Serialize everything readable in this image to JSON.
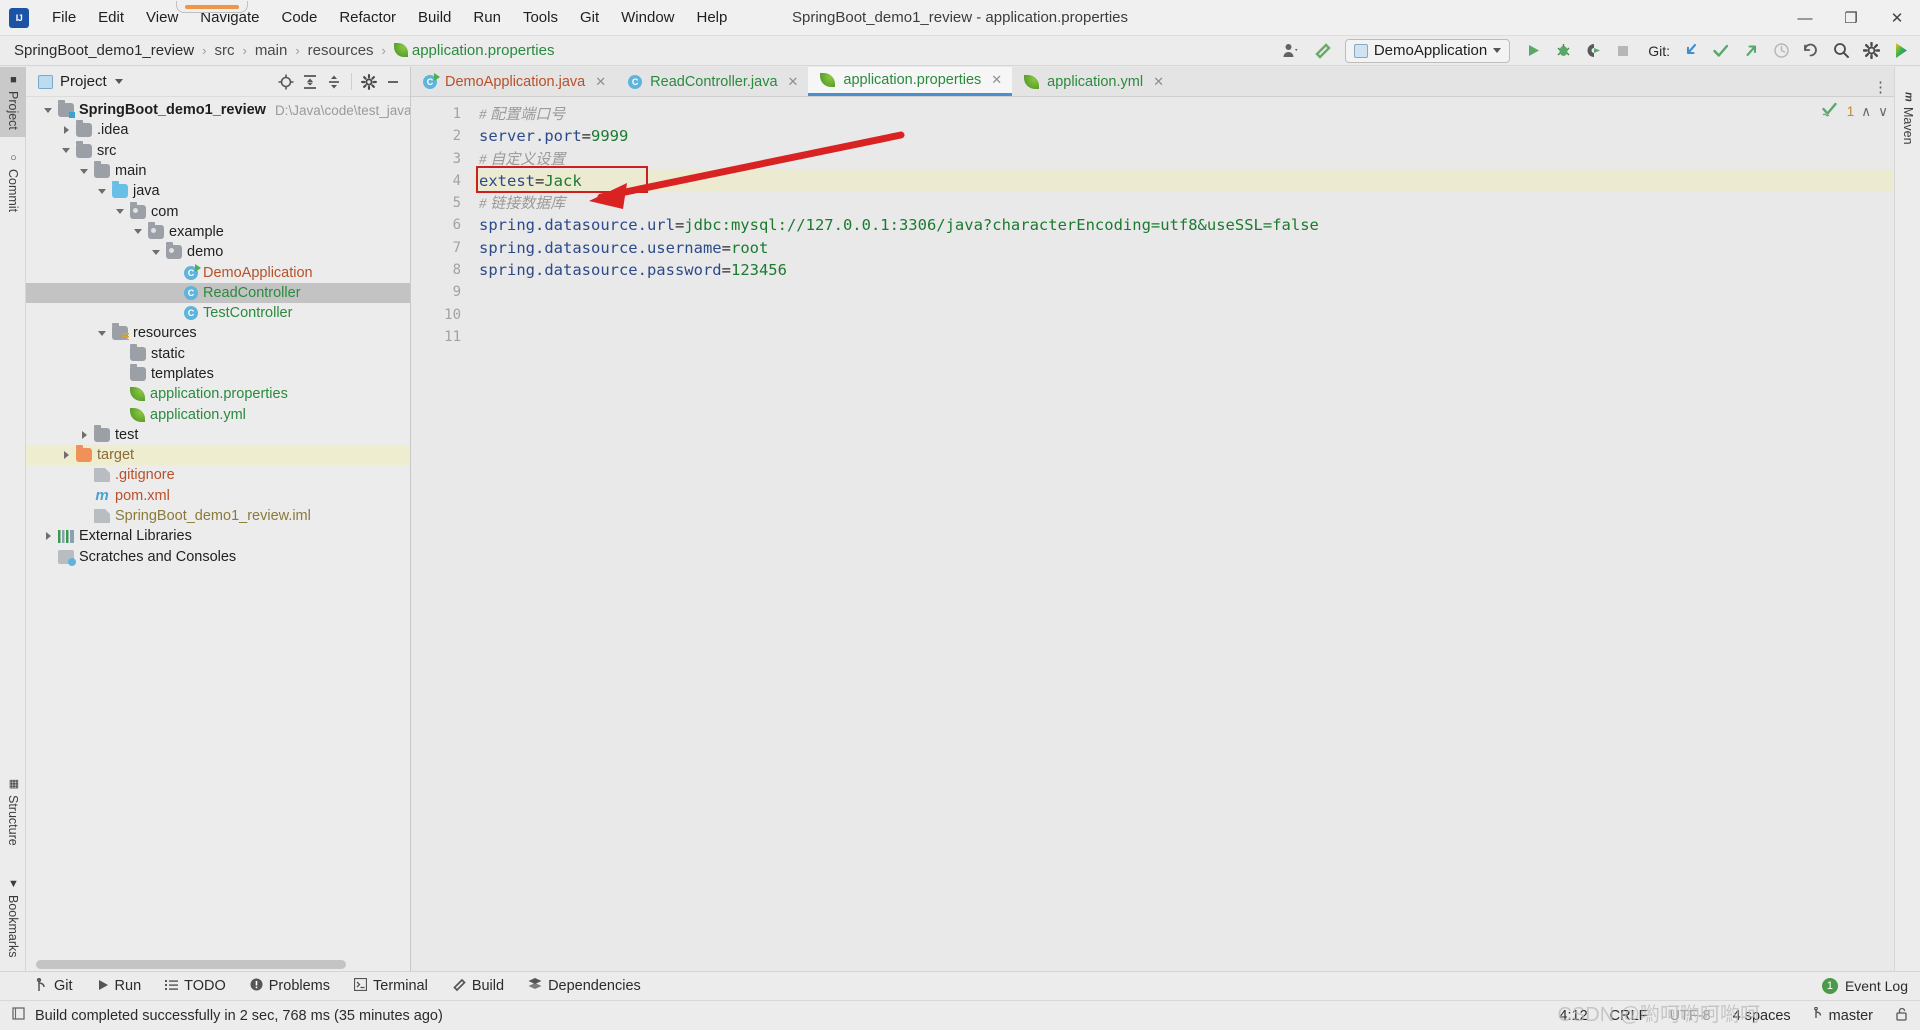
{
  "window": {
    "title": "SpringBoot_demo1_review - application.properties",
    "minimize": "—",
    "maximize": "❐",
    "close": "✕"
  },
  "menu": {
    "items": [
      {
        "label": "File"
      },
      {
        "label": "Edit"
      },
      {
        "label": "View"
      },
      {
        "label": "Navigate"
      },
      {
        "label": "Code"
      },
      {
        "label": "Refactor"
      },
      {
        "label": "Build"
      },
      {
        "label": "Run"
      },
      {
        "label": "Tools"
      },
      {
        "label": "Git"
      },
      {
        "label": "Window"
      },
      {
        "label": "Help"
      }
    ]
  },
  "breadcrumb": {
    "items": [
      {
        "label": "SpringBoot_demo1_review",
        "style": "plain"
      },
      {
        "label": "src",
        "style": "dim"
      },
      {
        "label": "main",
        "style": "dim"
      },
      {
        "label": "resources",
        "style": "dim"
      },
      {
        "label": "application.properties",
        "style": "green"
      }
    ],
    "separator": "›"
  },
  "toolbar": {
    "profile_icon": "user-profile-icon",
    "build_icon": "hammer-icon",
    "run_config": "DemoApplication",
    "run_label": "Run",
    "debug_label": "Debug",
    "coverage_label": "Run with Coverage",
    "stop_label": "Stop",
    "git_label": "Git:",
    "git_update_label": "Update Project",
    "git_commit_label": "Commit",
    "git_push_label": "Push",
    "git_history_label": "History",
    "git_rollback_label": "Rollback",
    "search_label": "Search Everywhere",
    "settings_label": "Settings",
    "ide_icon": "ide-gradient-icon"
  },
  "left_strip": {
    "items": [
      {
        "label": "Project",
        "icon": "project-folder-icon",
        "selected": true
      },
      {
        "label": "Commit",
        "icon": "commit-icon",
        "selected": false
      }
    ],
    "bottom_items": [
      {
        "label": "Structure",
        "icon": "structure-icon"
      },
      {
        "label": "Bookmarks",
        "icon": "bookmark-icon"
      }
    ]
  },
  "right_strip": {
    "items": [
      {
        "label": "Maven",
        "icon": "maven-m-icon"
      }
    ]
  },
  "project_panel": {
    "title": "Project",
    "actions": [
      "locate-icon",
      "expand-all-icon",
      "collapse-all-icon",
      "gear-icon",
      "hide-icon"
    ],
    "tree": [
      {
        "indent": 0,
        "chevron": "open",
        "icon": "module-folder-icon",
        "label": "SpringBoot_demo1_review",
        "color": "plain",
        "bold": true,
        "path": "D:\\Java\\code\\test_java\\SpringB…"
      },
      {
        "indent": 1,
        "chevron": "closed",
        "icon": "folder-icon",
        "label": ".idea",
        "color": "plain"
      },
      {
        "indent": 1,
        "chevron": "open",
        "icon": "folder-icon",
        "label": "src",
        "color": "plain"
      },
      {
        "indent": 2,
        "chevron": "open",
        "icon": "folder-icon",
        "label": "main",
        "color": "plain"
      },
      {
        "indent": 3,
        "chevron": "open",
        "icon": "source-folder-icon",
        "label": "java",
        "color": "plain"
      },
      {
        "indent": 4,
        "chevron": "open",
        "icon": "package-icon",
        "label": "com",
        "color": "plain"
      },
      {
        "indent": 5,
        "chevron": "open",
        "icon": "package-icon",
        "label": "example",
        "color": "plain"
      },
      {
        "indent": 6,
        "chevron": "open",
        "icon": "package-icon",
        "label": "demo",
        "color": "plain"
      },
      {
        "indent": 7,
        "chevron": "none",
        "icon": "java-class-run-icon",
        "label": "DemoApplication",
        "color": "orange"
      },
      {
        "indent": 7,
        "chevron": "none",
        "icon": "java-class-icon",
        "label": "ReadController",
        "color": "green",
        "selected": true
      },
      {
        "indent": 7,
        "chevron": "none",
        "icon": "java-class-icon",
        "label": "TestController",
        "color": "green"
      },
      {
        "indent": 3,
        "chevron": "open",
        "icon": "resource-folder-icon",
        "label": "resources",
        "color": "plain"
      },
      {
        "indent": 4,
        "chevron": "none",
        "icon": "folder-icon",
        "label": "static",
        "color": "plain"
      },
      {
        "indent": 4,
        "chevron": "none",
        "icon": "folder-icon",
        "label": "templates",
        "color": "plain"
      },
      {
        "indent": 4,
        "chevron": "none",
        "icon": "spring-leaf-icon",
        "label": "application.properties",
        "color": "green"
      },
      {
        "indent": 4,
        "chevron": "none",
        "icon": "spring-leaf-icon",
        "label": "application.yml",
        "color": "green"
      },
      {
        "indent": 2,
        "chevron": "closed",
        "icon": "folder-icon",
        "label": "test",
        "color": "plain"
      },
      {
        "indent": 1,
        "chevron": "closed",
        "icon": "excluded-folder-icon",
        "label": "target",
        "color": "brown",
        "highlight": true
      },
      {
        "indent": 2,
        "chevron": "none",
        "icon": "ignored-file-icon",
        "label": ".gitignore",
        "color": "orange"
      },
      {
        "indent": 2,
        "chevron": "none",
        "icon": "maven-m-icon",
        "label": "pom.xml",
        "color": "orange"
      },
      {
        "indent": 2,
        "chevron": "none",
        "icon": "iml-file-icon",
        "label": "SpringBoot_demo1_review.iml",
        "color": "tan"
      },
      {
        "indent": 0,
        "chevron": "closed",
        "icon": "external-libraries-icon",
        "label": "External Libraries",
        "color": "plain"
      },
      {
        "indent": 0,
        "chevron": "none",
        "icon": "scratches-icon",
        "label": "Scratches and Consoles",
        "color": "plain"
      }
    ]
  },
  "editor": {
    "tabs": [
      {
        "label": "DemoApplication.java",
        "icon": "java-class-run-icon",
        "color": "orange",
        "active": false,
        "close": "✕"
      },
      {
        "label": "ReadController.java",
        "icon": "java-class-icon",
        "color": "green",
        "active": false,
        "close": "✕"
      },
      {
        "label": "application.properties",
        "icon": "spring-leaf-icon",
        "color": "green",
        "active": true,
        "close": "✕"
      },
      {
        "label": "application.yml",
        "icon": "spring-leaf-icon",
        "color": "green",
        "active": false,
        "close": "✕"
      }
    ],
    "tabs_overflow_icon": "more-options-icon",
    "inspection": {
      "status_icon": "inspection-ok-icon",
      "warning_count": "1",
      "prev": "∧",
      "next": "∨"
    },
    "line_numbers": [
      "1",
      "2",
      "3",
      "4",
      "5",
      "6",
      "7",
      "8",
      "9",
      "10",
      "11"
    ],
    "lines": [
      {
        "n": 1,
        "type": "comment",
        "text": "# 配置端口号"
      },
      {
        "n": 2,
        "type": "prop",
        "key": "server.port",
        "value": "9999"
      },
      {
        "n": 3,
        "type": "comment",
        "text": "# 自定义设置"
      },
      {
        "n": 4,
        "type": "prop",
        "key": "extest",
        "value": "Jack",
        "current": true,
        "boxed": true
      },
      {
        "n": 5,
        "type": "comment",
        "text": "# 链接数据库"
      },
      {
        "n": 6,
        "type": "prop",
        "key": "spring.datasource.url",
        "value": "jdbc:mysql://127.0.0.1:3306/java?characterEncoding=utf8&useSSL=false"
      },
      {
        "n": 7,
        "type": "prop",
        "key": "spring.datasource.username",
        "value": "root"
      },
      {
        "n": 8,
        "type": "prop",
        "key": "spring.datasource.password",
        "value": "123456"
      },
      {
        "n": 9,
        "type": "blank",
        "text": ""
      },
      {
        "n": 10,
        "type": "blank",
        "text": ""
      },
      {
        "n": 11,
        "type": "blank",
        "text": ""
      }
    ],
    "annotation": {
      "type": "red-arrow",
      "note": "points at extest=Jack"
    }
  },
  "bottom_bar": {
    "items": [
      {
        "label": "Git",
        "icon": "git-branch-icon"
      },
      {
        "label": "Run",
        "icon": "run-play-icon"
      },
      {
        "label": "TODO",
        "icon": "todo-list-icon"
      },
      {
        "label": "Problems",
        "icon": "problems-icon"
      },
      {
        "label": "Terminal",
        "icon": "terminal-icon"
      },
      {
        "label": "Build",
        "icon": "build-hammer-icon"
      },
      {
        "label": "Dependencies",
        "icon": "dependencies-icon"
      }
    ],
    "event_log": {
      "count": "1",
      "label": "Event Log"
    }
  },
  "status_bar": {
    "message": "Build completed successfully in 2 sec, 768 ms (35 minutes ago)",
    "message_icon": "build-status-icon",
    "caret_position": "4:12",
    "line_separator": "CRLF",
    "encoding": "UTF-8",
    "indent": "4 spaces",
    "branch_icon": "git-branch-icon",
    "branch": "master",
    "lock_icon": "unlocked-icon",
    "watermark": "CSDN @喲呵喲呵喲呵"
  },
  "colors": {
    "accent_blue": "#4a8fd0",
    "green": "#2a8a3e",
    "orange": "#b8502a",
    "annotation_red": "#cc2020",
    "highlight_row": "#eeedcf",
    "selection": "#c3c3c3"
  }
}
